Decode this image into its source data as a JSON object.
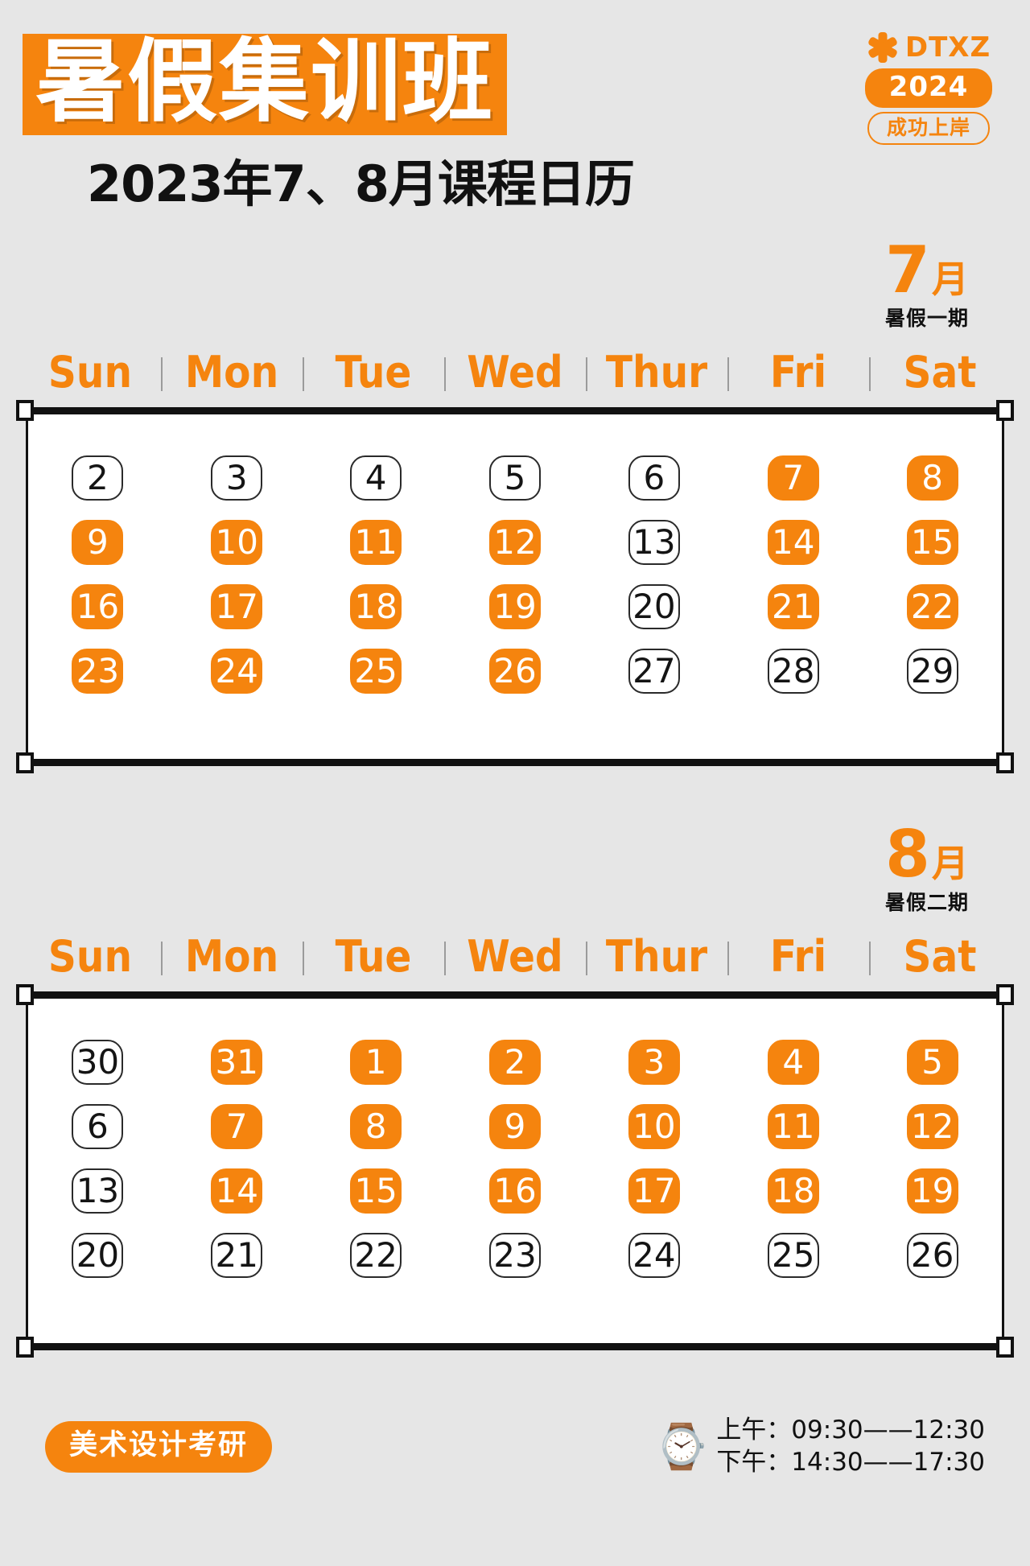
{
  "header": {
    "title": "暑假集训班",
    "subtitle": "2023年7、8月课程日历"
  },
  "logo": {
    "star_icon": "star-asterisk-icon",
    "brand": "DTXZ",
    "year": "2024",
    "slogan": "成功上岸"
  },
  "colors": {
    "accent": "#F5840E",
    "background": "#E6E6E6",
    "frame": "#111111",
    "text": "#141414"
  },
  "weekdays": [
    "Sun",
    "Mon",
    "Tue",
    "Wed",
    "Thur",
    "Fri",
    "Sat"
  ],
  "months": [
    {
      "number": "7",
      "unit": "月",
      "phase": "暑假一期",
      "weeks": [
        [
          {
            "day": "2",
            "active": false
          },
          {
            "day": "3",
            "active": false
          },
          {
            "day": "4",
            "active": false
          },
          {
            "day": "5",
            "active": false
          },
          {
            "day": "6",
            "active": false
          },
          {
            "day": "7",
            "active": true
          },
          {
            "day": "8",
            "active": true
          }
        ],
        [
          {
            "day": "9",
            "active": true
          },
          {
            "day": "10",
            "active": true
          },
          {
            "day": "11",
            "active": true
          },
          {
            "day": "12",
            "active": true
          },
          {
            "day": "13",
            "active": false
          },
          {
            "day": "14",
            "active": true
          },
          {
            "day": "15",
            "active": true
          }
        ],
        [
          {
            "day": "16",
            "active": true
          },
          {
            "day": "17",
            "active": true
          },
          {
            "day": "18",
            "active": true
          },
          {
            "day": "19",
            "active": true
          },
          {
            "day": "20",
            "active": false
          },
          {
            "day": "21",
            "active": true
          },
          {
            "day": "22",
            "active": true
          }
        ],
        [
          {
            "day": "23",
            "active": true
          },
          {
            "day": "24",
            "active": true
          },
          {
            "day": "25",
            "active": true
          },
          {
            "day": "26",
            "active": true
          },
          {
            "day": "27",
            "active": false
          },
          {
            "day": "28",
            "active": false
          },
          {
            "day": "29",
            "active": false
          }
        ]
      ]
    },
    {
      "number": "8",
      "unit": "月",
      "phase": "暑假二期",
      "weeks": [
        [
          {
            "day": "30",
            "active": false
          },
          {
            "day": "31",
            "active": true
          },
          {
            "day": "1",
            "active": true
          },
          {
            "day": "2",
            "active": true
          },
          {
            "day": "3",
            "active": true
          },
          {
            "day": "4",
            "active": true
          },
          {
            "day": "5",
            "active": true
          }
        ],
        [
          {
            "day": "6",
            "active": false
          },
          {
            "day": "7",
            "active": true
          },
          {
            "day": "8",
            "active": true
          },
          {
            "day": "9",
            "active": true
          },
          {
            "day": "10",
            "active": true
          },
          {
            "day": "11",
            "active": true
          },
          {
            "day": "12",
            "active": true
          }
        ],
        [
          {
            "day": "13",
            "active": false
          },
          {
            "day": "14",
            "active": true
          },
          {
            "day": "15",
            "active": true
          },
          {
            "day": "16",
            "active": true
          },
          {
            "day": "17",
            "active": true
          },
          {
            "day": "18",
            "active": true
          },
          {
            "day": "19",
            "active": true
          }
        ],
        [
          {
            "day": "20",
            "active": false
          },
          {
            "day": "21",
            "active": false
          },
          {
            "day": "22",
            "active": false
          },
          {
            "day": "23",
            "active": false
          },
          {
            "day": "24",
            "active": false
          },
          {
            "day": "25",
            "active": false
          },
          {
            "day": "26",
            "active": false
          }
        ]
      ]
    }
  ],
  "footer": {
    "tag": "美术设计考研",
    "watch_icon": "wristwatch-icon",
    "time_morning": "上午：09:30——12:30",
    "time_afternoon": "下午：14:30——17:30"
  }
}
